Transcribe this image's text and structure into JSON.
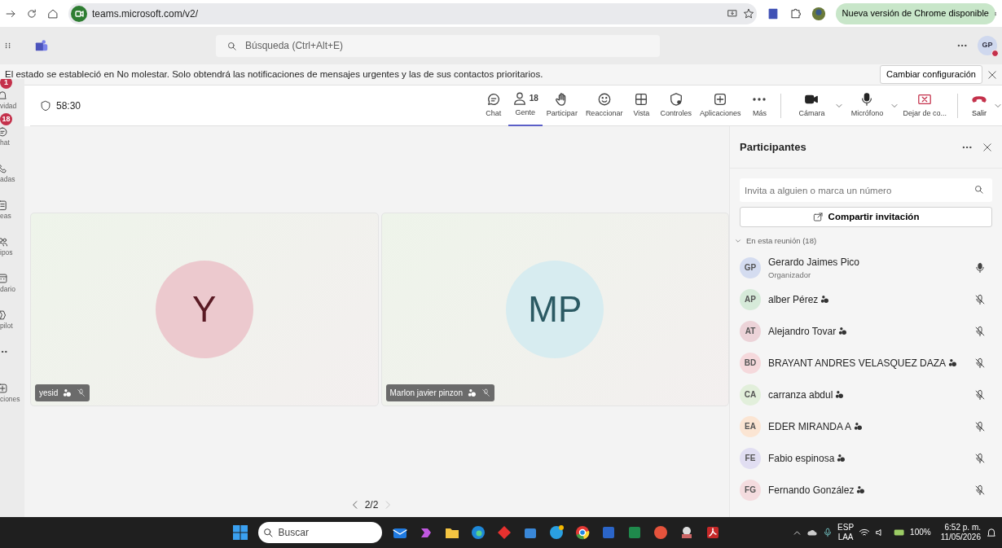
{
  "browser": {
    "url": "teams.microsoft.com/v2/",
    "update_button": "Nueva versión de Chrome disponible"
  },
  "teams_header": {
    "search_placeholder": "Búsqueda (Ctrl+Alt+E)",
    "avatar": "GP"
  },
  "notice": {
    "text": "El estado se estableció en No molestar. Solo obtendrá las notificaciones de mensajes urgentes y las de sus contactos prioritarios.",
    "button": "Cambiar configuración"
  },
  "rail": [
    {
      "kind": "activity",
      "label": "vidad",
      "badge": "1"
    },
    {
      "kind": "chat",
      "label": "hat",
      "badge": "18"
    },
    {
      "kind": "calls",
      "label": "adas"
    },
    {
      "kind": "tasks",
      "label": "eas"
    },
    {
      "kind": "teams",
      "label": "ipos"
    },
    {
      "kind": "calendar",
      "label": "dario"
    },
    {
      "kind": "copilot",
      "label": "pilot"
    },
    {
      "kind": "more"
    },
    {
      "kind": "apps",
      "label": "ciones"
    }
  ],
  "meeting": {
    "timer": "58:30",
    "toolbar": [
      {
        "kind": "chat",
        "label": "Chat",
        "selected": false
      },
      {
        "kind": "people",
        "label": "Gente",
        "count": "18",
        "selected": true
      },
      {
        "kind": "hand",
        "label": "Participar",
        "selected": false
      },
      {
        "kind": "react",
        "label": "Reaccionar",
        "selected": false
      },
      {
        "kind": "view",
        "label": "Vista",
        "selected": false
      },
      {
        "kind": "shield",
        "label": "Controles",
        "selected": false
      },
      {
        "kind": "plus",
        "label": "Aplicaciones",
        "selected": false
      },
      {
        "kind": "more",
        "label": "Más",
        "selected": false
      },
      {
        "kind": "camera",
        "label": "Cámara",
        "selected": false
      },
      {
        "kind": "mic",
        "label": "Micrófono",
        "selected": false
      },
      {
        "kind": "stopshare",
        "label": "Dejar de co...",
        "selected": false
      },
      {
        "kind": "leave",
        "label": "Salir",
        "selected": false
      }
    ]
  },
  "tiles": [
    {
      "initials": "Y",
      "name": "yesid",
      "color": "#ecc9ce"
    },
    {
      "initials": "MP",
      "name": "Marlon javier pinzon",
      "color": "#d7ecf0"
    }
  ],
  "pager": "2/2",
  "panel": {
    "title": "Participantes",
    "search_placeholder": "Invita a alguien o marca un número",
    "share_button": "Compartir invitación",
    "section": "En esta reunión (18)",
    "expanded": true,
    "participants": [
      {
        "initials": "GP",
        "name": "Gerardo Jaimes Pico",
        "role": "Organizador",
        "guest": false,
        "muted": false,
        "color": "#d4dcf0"
      },
      {
        "initials": "AP",
        "name": "alber Pérez",
        "guest": true,
        "muted": true,
        "color": "#d6ead9"
      },
      {
        "initials": "AT",
        "name": "Alejandro Tovar",
        "guest": true,
        "muted": true,
        "color": "#ecd3d8"
      },
      {
        "initials": "BD",
        "name": "BRAYANT ANDRES VELASQUEZ DAZA",
        "guest": true,
        "muted": true,
        "color": "#f5d9dc"
      },
      {
        "initials": "CA",
        "name": "carranza abdul",
        "guest": true,
        "muted": true,
        "color": "#e2efdb"
      },
      {
        "initials": "EA",
        "name": "EDER MIRANDA A",
        "guest": true,
        "muted": true,
        "color": "#fbe5d3"
      },
      {
        "initials": "FE",
        "name": "Fabio espinosa",
        "guest": true,
        "muted": true,
        "color": "#e1def2"
      },
      {
        "initials": "FG",
        "name": "Fernando González",
        "guest": true,
        "muted": true,
        "color": "#f4dcdf"
      }
    ]
  },
  "taskbar": {
    "search": "Buscar",
    "lang_top": "ESP",
    "lang_bottom": "LAA",
    "battery": "100%",
    "time": "6:52 p. m.",
    "date": "11/05/2026"
  }
}
